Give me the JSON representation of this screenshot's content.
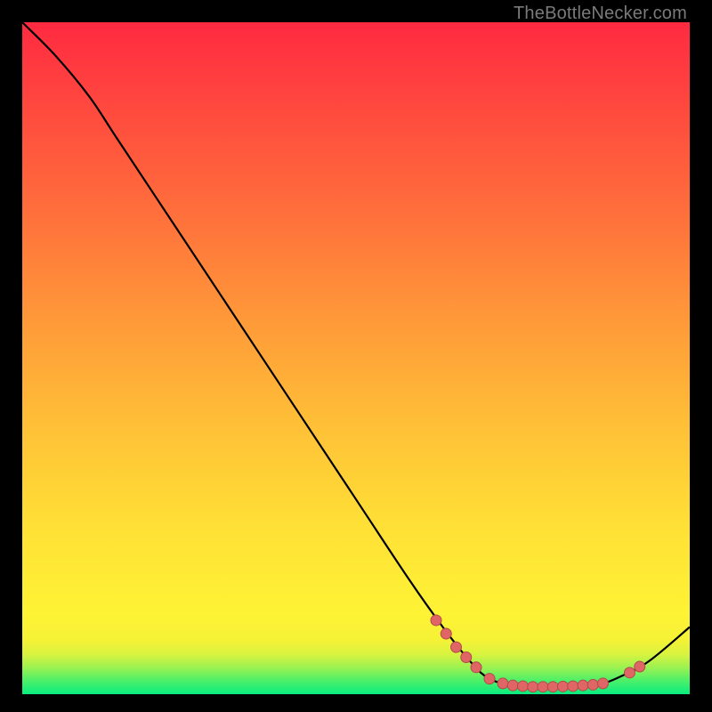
{
  "attribution": "TheBottleNecker.com",
  "chart_data": {
    "type": "line",
    "title": "",
    "xlabel": "",
    "ylabel": "",
    "xlim": [
      0,
      100
    ],
    "ylim": [
      0,
      100
    ],
    "background_gradient": {
      "stops": [
        {
          "y": 0,
          "color": "#08ed7f"
        },
        {
          "y": 2,
          "color": "#4cf069"
        },
        {
          "y": 4,
          "color": "#9cf251"
        },
        {
          "y": 6,
          "color": "#d9f33f"
        },
        {
          "y": 8,
          "color": "#f5f236"
        },
        {
          "y": 12,
          "color": "#fef335"
        },
        {
          "y": 25,
          "color": "#ffe036"
        },
        {
          "y": 40,
          "color": "#ffc037"
        },
        {
          "y": 55,
          "color": "#ff9b39"
        },
        {
          "y": 70,
          "color": "#ff733b"
        },
        {
          "y": 85,
          "color": "#ff4e3e"
        },
        {
          "y": 100,
          "color": "#ff2a41"
        }
      ]
    },
    "series": [
      {
        "name": "curve",
        "color": "#000000",
        "width": 2.2,
        "points": [
          {
            "x": 0,
            "y": 100
          },
          {
            "x": 5,
            "y": 95
          },
          {
            "x": 10,
            "y": 89
          },
          {
            "x": 14,
            "y": 83
          },
          {
            "x": 20,
            "y": 74
          },
          {
            "x": 30,
            "y": 59
          },
          {
            "x": 40,
            "y": 44
          },
          {
            "x": 50,
            "y": 29
          },
          {
            "x": 58,
            "y": 17
          },
          {
            "x": 63,
            "y": 10
          },
          {
            "x": 67,
            "y": 5
          },
          {
            "x": 70,
            "y": 2.3
          },
          {
            "x": 74,
            "y": 1.3
          },
          {
            "x": 80,
            "y": 1.1
          },
          {
            "x": 86,
            "y": 1.4
          },
          {
            "x": 90,
            "y": 2.8
          },
          {
            "x": 94,
            "y": 5
          },
          {
            "x": 100,
            "y": 10
          }
        ]
      }
    ],
    "markers": {
      "color": "#e06666",
      "stroke": "#b24a4a",
      "radius": 6,
      "points": [
        {
          "x": 62,
          "y": 11
        },
        {
          "x": 63.5,
          "y": 9
        },
        {
          "x": 65,
          "y": 7
        },
        {
          "x": 66.5,
          "y": 5.5
        },
        {
          "x": 68,
          "y": 4
        },
        {
          "x": 70,
          "y": 2.3
        },
        {
          "x": 72,
          "y": 1.6
        },
        {
          "x": 73.5,
          "y": 1.3
        },
        {
          "x": 75,
          "y": 1.2
        },
        {
          "x": 76.5,
          "y": 1.1
        },
        {
          "x": 78,
          "y": 1.1
        },
        {
          "x": 79.5,
          "y": 1.1
        },
        {
          "x": 81,
          "y": 1.15
        },
        {
          "x": 82.5,
          "y": 1.2
        },
        {
          "x": 84,
          "y": 1.3
        },
        {
          "x": 85.5,
          "y": 1.4
        },
        {
          "x": 87,
          "y": 1.6
        },
        {
          "x": 91,
          "y": 3.2
        },
        {
          "x": 92.5,
          "y": 4.1
        }
      ]
    }
  }
}
